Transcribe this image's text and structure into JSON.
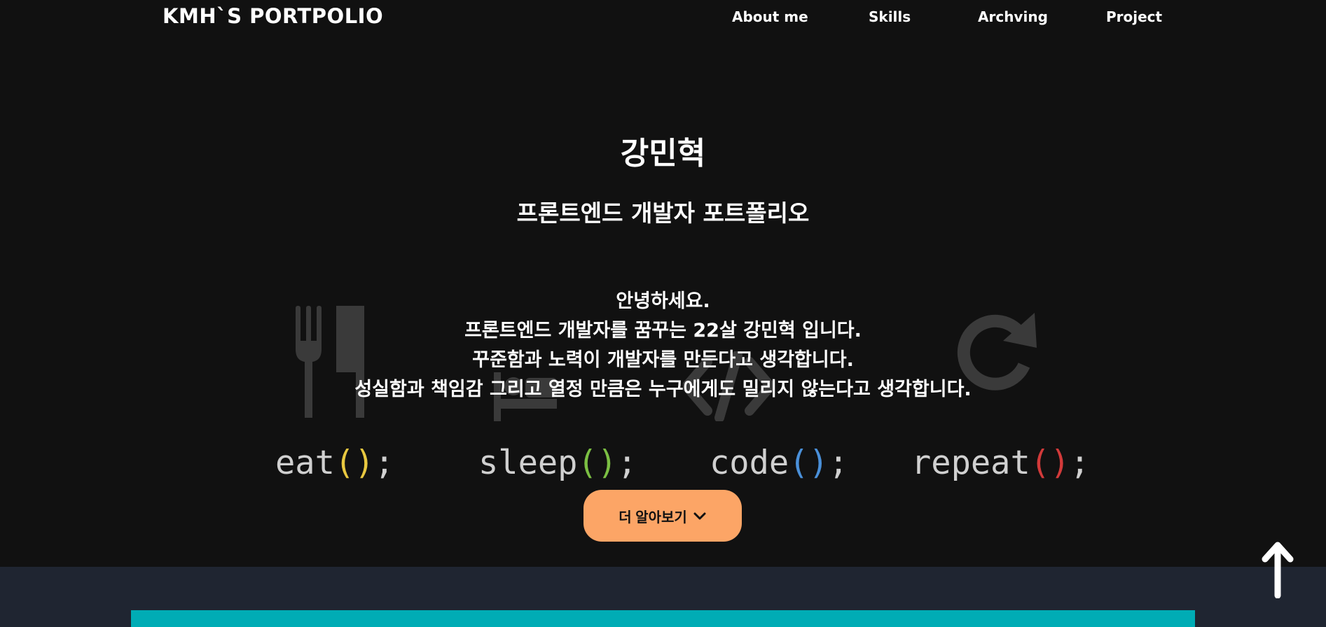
{
  "header": {
    "logo": "KMH`S PORTPOLIO",
    "nav": [
      "About me",
      "Skills",
      "Archving",
      "Project"
    ]
  },
  "hero": {
    "name": "강민혁",
    "subtitle": "프론트엔드 개발자 포트폴리오",
    "intro": [
      "안녕하세요.",
      "프론트엔드 개발자를 꿈꾸는 22살 강민혁 입니다.",
      "꾸준함과 노력이 개발자를 만든다고 생각합니다.",
      "성실함과 책임감 그리고 열정 만큼은 누구에게도 밀리지 않는다고 생각합니다."
    ],
    "motto": [
      {
        "word": "eat",
        "paren": "()",
        "semi": ";",
        "color": "#e8c840"
      },
      {
        "word": "sleep",
        "paren": "()",
        "semi": ";",
        "color": "#7bbf43"
      },
      {
        "word": "code",
        "paren": "()",
        "semi": ";",
        "color": "#4a90d9"
      },
      {
        "word": "repeat",
        "paren": "()",
        "semi": ";",
        "color": "#d23a3a"
      }
    ],
    "more_button": "더 알아보기"
  },
  "colors": {
    "background": "#111111",
    "accent_button": "#fca566",
    "section_two": "#1f2531",
    "teal": "#00acb5"
  }
}
